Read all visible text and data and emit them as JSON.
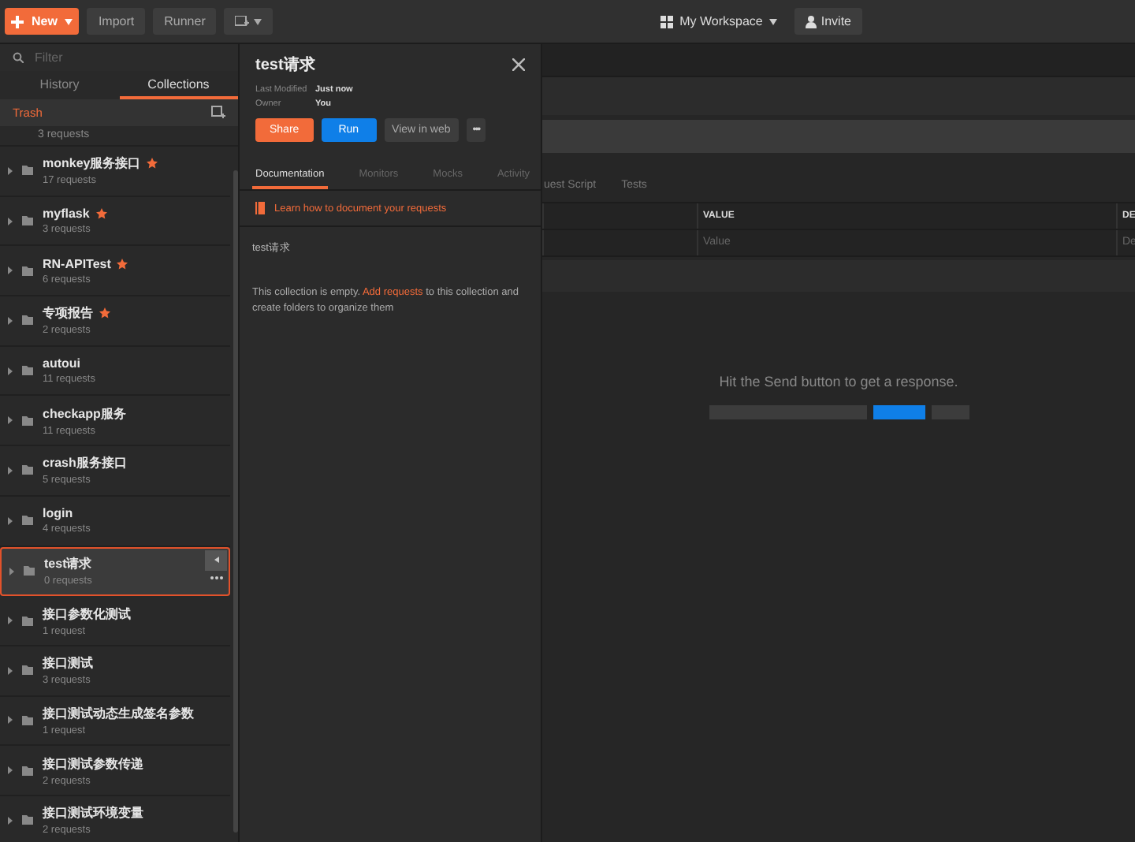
{
  "toolbar": {
    "new_button": "New",
    "buttons": [
      "Import",
      "Runner"
    ],
    "workspace": "My Workspace",
    "invite": "Invite"
  },
  "sidebar": {
    "filter_placeholder": "Filter",
    "tabs": [
      {
        "label": "History",
        "selected": false
      },
      {
        "label": "Collections",
        "selected": true
      }
    ],
    "trash": "Trash",
    "scrolled_item_count": "3 requests",
    "collections": [
      {
        "name": "monkey服务接口",
        "count": "17 requests",
        "starred": true,
        "selected": false
      },
      {
        "name": "myflask",
        "count": "3 requests",
        "starred": true,
        "selected": false
      },
      {
        "name": "RN-APITest",
        "count": "6 requests",
        "starred": true,
        "selected": false
      },
      {
        "name": "专项报告",
        "count": "2 requests",
        "starred": true,
        "selected": false
      },
      {
        "name": "autoui",
        "count": "11 requests",
        "starred": false,
        "selected": false
      },
      {
        "name": "checkapp服务",
        "count": "11 requests",
        "starred": false,
        "selected": false
      },
      {
        "name": "crash服务接口",
        "count": "5 requests",
        "starred": false,
        "selected": false
      },
      {
        "name": "login",
        "count": "4 requests",
        "starred": false,
        "selected": false
      },
      {
        "name": "test请求",
        "count": "0 requests",
        "starred": false,
        "selected": true
      },
      {
        "name": "接口参数化测试",
        "count": "1 request",
        "starred": false,
        "selected": false
      },
      {
        "name": "接口测试",
        "count": "3 requests",
        "starred": false,
        "selected": false
      },
      {
        "name": "接口测试动态生成签名参数",
        "count": "1 request",
        "starred": false,
        "selected": false
      },
      {
        "name": "接口测试参数传递",
        "count": "2 requests",
        "starred": false,
        "selected": false
      },
      {
        "name": "接口测试环境变量",
        "count": "2 requests",
        "starred": false,
        "selected": false
      }
    ]
  },
  "request": {
    "tabs": [
      "uest Script",
      "Tests"
    ],
    "columns": [
      "VALUE",
      "DE"
    ],
    "placeholders": [
      "Value",
      "De"
    ],
    "response_hint": "Hit the Send button to get a response."
  },
  "panel": {
    "title": "test请求",
    "meta": [
      {
        "label": "Last Modified",
        "value": "Just now"
      },
      {
        "label": "Owner",
        "value": "You"
      }
    ],
    "buttons": [
      {
        "label": "Share",
        "kind": "share"
      },
      {
        "label": "Run",
        "kind": "run"
      },
      {
        "label": "View in web",
        "kind": "plain"
      },
      {
        "label": "•••",
        "kind": "more"
      }
    ],
    "tabs": [
      {
        "label": "Documentation",
        "selected": true
      },
      {
        "label": "Monitors",
        "selected": false
      },
      {
        "label": "Mocks",
        "selected": false
      },
      {
        "label": "Activity",
        "selected": false
      }
    ],
    "doc_link": "Learn how to document your requests",
    "name": "test请求",
    "empty_text": "This collection is empty. **Add requests** to this collection and create folders to organize them"
  }
}
